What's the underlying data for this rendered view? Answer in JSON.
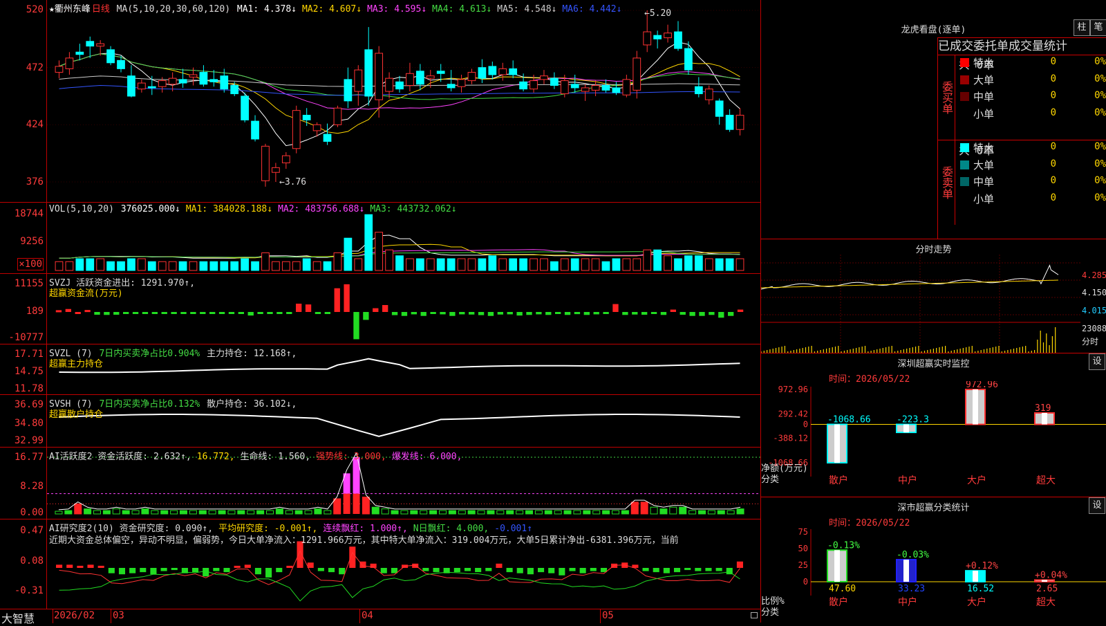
{
  "stock": {
    "name": "★衢州东峰",
    "period": "日线"
  },
  "ma_legend": {
    "params": "MA(5,10,20,30,60,120)",
    "items": [
      {
        "label": "MA1: 4.378↓",
        "color": "#ffffff"
      },
      {
        "label": "MA2: 4.607↓",
        "color": "#ffd700"
      },
      {
        "label": "MA3: 4.595↓",
        "color": "#ff44ff"
      },
      {
        "label": "MA4: 4.613↓",
        "color": "#44dd44"
      },
      {
        "label": "MA5: 4.548↓",
        "color": "#cccccc"
      },
      {
        "label": "MA6: 4.442↓",
        "color": "#3355ff"
      }
    ],
    "high_mark": "←5.20",
    "low_mark": "←3.76"
  },
  "price_axis": [
    "520",
    "472",
    "424",
    "376"
  ],
  "vol": {
    "params": "VOL(5,10,20)",
    "items": [
      {
        "label": "376025.000↓",
        "color": "#ffffff"
      },
      {
        "label": "MA1: 384028.188↓",
        "color": "#ffd700"
      },
      {
        "label": "MA2: 483756.688↓",
        "color": "#ff44ff"
      },
      {
        "label": "MA3: 443732.062↓",
        "color": "#44dd44"
      }
    ],
    "axis": [
      "18744",
      "9256",
      "×100"
    ]
  },
  "svzj": {
    "line1": "SVZJ  活跃资金进出: 1291.970↑,",
    "line2": "超赢资金流(万元)",
    "axis": [
      "11155",
      "189",
      "-10777"
    ]
  },
  "svzl": {
    "line1a": "SVZL (7) ",
    "line1b": "7日内买卖净占比0.904%",
    "line1c": " 主力持仓: 12.168↑,",
    "line2": "超赢主力持仓",
    "axis": [
      "17.71",
      "14.75",
      "11.78"
    ]
  },
  "svsh": {
    "line1a": "SVSH (7) ",
    "line1b": "7日内买卖净占比0.132%",
    "line1c": " 散户持仓: 36.102↓,",
    "line2": "超赢散户持仓",
    "axis": [
      "36.69",
      "34.80",
      "32.99"
    ]
  },
  "ai_active": {
    "items": [
      {
        "label": "AI活跃度2 资金活跃度: 2.632↑,",
        "color": "#dddddd"
      },
      {
        "label": "16.772,",
        "color": "#ffd700"
      },
      {
        "label": "生命线: 1.560,",
        "color": "#dddddd"
      },
      {
        "label": "强势线: 3.000,",
        "color": "#ff3333"
      },
      {
        "label": "爆发线: 6.000,",
        "color": "#ff44ff"
      }
    ],
    "axis": [
      "16.77",
      "8.28",
      "0.00"
    ]
  },
  "ai_research": {
    "items": [
      {
        "label": "AI研究度2(10) 资金研究度: 0.090↑,",
        "color": "#dddddd"
      },
      {
        "label": "平均研究度: -0.001↑,",
        "color": "#ffd700"
      },
      {
        "label": "连续飘红: 1.000↑,",
        "color": "#ff44ff"
      },
      {
        "label": "N日飘红: 4.000,",
        "color": "#44dd44"
      },
      {
        "label": "-0.001↑",
        "color": "#3355ff"
      }
    ],
    "comment": "近期大资金总体偏空，异动不明显，偏弱势，今日大单净流入：1291.966万元，其中特大单净流入：319.004万元，大单5日累计净出-6381.396万元，当前",
    "axis": [
      "0.47",
      "0.08",
      "-0.31"
    ]
  },
  "bottom": {
    "brand": "大智慧",
    "dates": [
      "2026/02",
      "03",
      "04",
      "05"
    ]
  },
  "lhb": {
    "title": "龙虎看盘(逐单)",
    "btn1": "柱",
    "btn2": "笔",
    "header": "已成交委托单成交量统计",
    "buy": {
      "side": "委买单",
      "total": "共 0单",
      "rows": [
        {
          "label": "特大",
          "count": "0",
          "pct": "0%",
          "color": "#ff0000"
        },
        {
          "label": "大单",
          "count": "0",
          "pct": "0%",
          "color": "#990000"
        },
        {
          "label": "中单",
          "count": "0",
          "pct": "0%",
          "color": "#660000"
        },
        {
          "label": "小单",
          "count": "0",
          "pct": "0%",
          "color": "#000000"
        }
      ]
    },
    "sell": {
      "side": "委卖单",
      "total": "共 0单",
      "rows": [
        {
          "label": "特大",
          "count": "0",
          "pct": "0%",
          "color": "#00ffff"
        },
        {
          "label": "大单",
          "count": "0",
          "pct": "0%",
          "color": "#008888"
        },
        {
          "label": "中单",
          "count": "0",
          "pct": "0%",
          "color": "#006666"
        },
        {
          "label": "小单",
          "count": "0",
          "pct": "0%",
          "color": "#000000"
        }
      ]
    }
  },
  "intraday": {
    "title": "分时走势",
    "axis": [
      "4.285",
      "4.150",
      "4.015",
      "23088",
      "分时"
    ]
  },
  "sz_monitor": {
    "title": "深圳超赢实时监控",
    "btn": "设",
    "time": "时间：2026/05/22",
    "axis": [
      "972.96",
      "292.42",
      "0",
      "-388.12",
      "-1068.66"
    ],
    "ylabel1": "净额(万元)",
    "ylabel2": "分类",
    "bars": [
      {
        "cat": "散户",
        "value": -1068.66,
        "label": "-1068.66"
      },
      {
        "cat": "中户",
        "value": -223.3,
        "label": "-223.3"
      },
      {
        "cat": "大户",
        "value": 972.96,
        "label": "972.96"
      },
      {
        "cat": "超大",
        "value": 319,
        "label": "319"
      }
    ]
  },
  "sz_class": {
    "title": "深市超赢分类统计",
    "btn": "设",
    "time": "时间：2026/05/22",
    "axis": [
      "75",
      "50",
      "25",
      "0"
    ],
    "ylabel1": "比例%",
    "ylabel2": "分类",
    "bars": [
      {
        "cat": "散户",
        "value": 47.6,
        "label": "47.60",
        "delta": "-0.13%"
      },
      {
        "cat": "中户",
        "value": 33.23,
        "label": "33.23",
        "delta": "-0.03%"
      },
      {
        "cat": "大户",
        "value": 16.52,
        "label": "16.52",
        "delta": "+0.12%"
      },
      {
        "cat": "超大",
        "value": 2.65,
        "label": "2.65",
        "delta": "+0.04%"
      }
    ]
  },
  "chart_data": {
    "type": "candlestick",
    "ylim": [
      376,
      520
    ],
    "ohlc": [
      [
        468,
        478,
        463,
        473
      ],
      [
        471,
        485,
        466,
        480
      ],
      [
        485,
        492,
        478,
        483
      ],
      [
        494,
        498,
        480,
        490
      ],
      [
        490,
        495,
        482,
        492
      ],
      [
        487,
        490,
        474,
        476
      ],
      [
        478,
        482,
        468,
        471
      ],
      [
        465,
        474,
        447,
        448
      ],
      [
        454,
        462,
        451,
        459
      ],
      [
        456,
        465,
        449,
        455
      ],
      [
        456,
        464,
        451,
        461
      ],
      [
        458,
        468,
        452,
        463
      ],
      [
        462,
        471,
        455,
        459
      ],
      [
        464,
        472,
        457,
        466
      ],
      [
        468,
        474,
        456,
        458
      ],
      [
        462,
        470,
        456,
        460
      ],
      [
        465,
        471,
        451,
        454
      ],
      [
        457,
        460,
        448,
        450
      ],
      [
        448,
        451,
        426,
        428
      ],
      [
        427,
        432,
        410,
        412
      ],
      [
        377,
        408,
        372,
        406
      ],
      [
        384,
        392,
        376,
        388
      ],
      [
        392,
        401,
        387,
        398
      ],
      [
        404,
        440,
        400,
        436
      ],
      [
        432,
        438,
        423,
        428
      ],
      [
        419,
        426,
        414,
        424
      ],
      [
        416,
        425,
        407,
        410
      ],
      [
        424,
        440,
        422,
        438
      ],
      [
        462,
        472,
        438,
        444
      ],
      [
        452,
        474,
        440,
        470
      ],
      [
        487,
        506,
        440,
        448
      ],
      [
        445,
        490,
        430,
        484
      ],
      [
        452,
        468,
        446,
        463
      ],
      [
        460,
        465,
        451,
        454
      ],
      [
        457,
        476,
        452,
        467
      ],
      [
        469,
        475,
        453,
        458
      ],
      [
        463,
        470,
        455,
        465
      ],
      [
        469,
        475,
        460,
        467
      ],
      [
        458,
        470,
        452,
        455
      ],
      [
        456,
        466,
        451,
        462
      ],
      [
        461,
        471,
        458,
        468
      ],
      [
        472,
        479,
        459,
        463
      ],
      [
        473,
        477,
        462,
        466
      ],
      [
        466,
        476,
        461,
        471
      ],
      [
        471,
        478,
        463,
        466
      ],
      [
        460,
        467,
        452,
        454
      ],
      [
        454,
        466,
        451,
        461
      ],
      [
        462,
        470,
        458,
        465
      ],
      [
        463,
        468,
        454,
        457
      ],
      [
        450,
        466,
        447,
        461
      ],
      [
        458,
        466,
        451,
        455
      ],
      [
        452,
        458,
        444,
        455
      ],
      [
        453,
        461,
        448,
        457
      ],
      [
        457,
        462,
        451,
        453
      ],
      [
        455,
        460,
        449,
        451
      ],
      [
        449,
        466,
        447,
        462
      ],
      [
        453,
        486,
        446,
        480
      ],
      [
        491,
        520,
        485,
        502
      ],
      [
        499,
        503,
        488,
        496
      ],
      [
        497,
        508,
        493,
        501
      ],
      [
        502,
        511,
        486,
        488
      ],
      [
        488,
        494,
        466,
        470
      ],
      [
        456,
        464,
        447,
        450
      ],
      [
        445,
        457,
        441,
        454
      ],
      [
        444,
        446,
        424,
        431
      ],
      [
        432,
        437,
        418,
        420
      ],
      [
        420,
        438,
        415,
        432
      ]
    ],
    "volume": [
      3,
      3,
      4,
      4,
      4,
      3,
      3,
      4,
      4,
      3,
      3,
      3,
      3,
      3,
      3,
      3,
      3,
      3,
      4,
      3,
      6,
      3,
      3,
      3,
      4,
      3,
      3,
      6,
      11,
      4,
      19,
      13,
      7,
      5,
      4,
      4,
      4,
      4,
      4,
      4,
      4,
      4,
      5,
      4,
      4,
      4,
      4,
      4,
      3,
      4,
      4,
      4,
      4,
      3,
      4,
      4,
      4,
      7,
      7,
      5,
      4,
      5,
      5,
      4,
      4,
      4,
      4
    ],
    "svzj": [
      90,
      150,
      0,
      100,
      -140,
      -150,
      -140,
      -70,
      -75,
      -80,
      -100,
      -95,
      -100,
      -90,
      -75,
      -90,
      -95,
      -85,
      -95,
      -90,
      -180,
      -90,
      -80,
      -80,
      -50,
      420,
      380,
      -45,
      -60,
      1200,
      1400,
      -1380,
      -400,
      190,
      350,
      -160,
      -200,
      -120,
      -200,
      -100,
      -120,
      -200,
      -120,
      -130,
      -160,
      -200,
      -130,
      -120,
      -180,
      -150,
      -120,
      -150,
      -100,
      -150,
      -110,
      -150,
      -120,
      -80,
      400,
      -150,
      -130,
      -140,
      -100,
      -150,
      120,
      -140,
      -200,
      -200,
      -150,
      -290,
      -200,
      120
    ],
    "ai_active": [
      0.8,
      1,
      3,
      1.5,
      1,
      1,
      1.5,
      1,
      1,
      1.5,
      1,
      1,
      1,
      1,
      1,
      1,
      1,
      1,
      1,
      1,
      1,
      1,
      1,
      1.5,
      1,
      1,
      1,
      1.5,
      1,
      4.5,
      12,
      16.77,
      5,
      2,
      1.5,
      1,
      1,
      1,
      1,
      1,
      1,
      1,
      1,
      1,
      1,
      1,
      1,
      1,
      1,
      1,
      1,
      1,
      1,
      1,
      1,
      1,
      1,
      1,
      1,
      1,
      3.5,
      3.5,
      2,
      1.5,
      2,
      2,
      1,
      1,
      1,
      1,
      1,
      1.5
    ],
    "ai_research": [
      0.03,
      0.03,
      0.02,
      0.03,
      0.02,
      -0.05,
      -0.06,
      -0.05,
      -0.04,
      -0.06,
      -0.03,
      -0.02,
      -0.05,
      -0.04,
      -0.08,
      -0.03,
      -0.04,
      0.02,
      0.03,
      -0.06,
      -0.09,
      -0.04,
      0.02,
      0.25,
      0.05,
      -0.03,
      -0.04,
      -0.06,
      0.2,
      0.06,
      0.04,
      -0.05,
      -0.05,
      0.03,
      0.04,
      -0.03,
      -0.04,
      -0.05,
      -0.04,
      -0.03,
      -0.04,
      -0.03,
      0.04,
      -0.04,
      -0.05,
      -0.06,
      -0.04,
      -0.05,
      -0.07,
      -0.03,
      -0.05,
      -0.03,
      -0.04,
      0.04,
      0.05,
      0.03,
      -0.03,
      -0.04,
      -0.05,
      -0.04,
      -0.02,
      -0.03,
      -0.03,
      -0.03,
      -0.06,
      0.06
    ]
  }
}
